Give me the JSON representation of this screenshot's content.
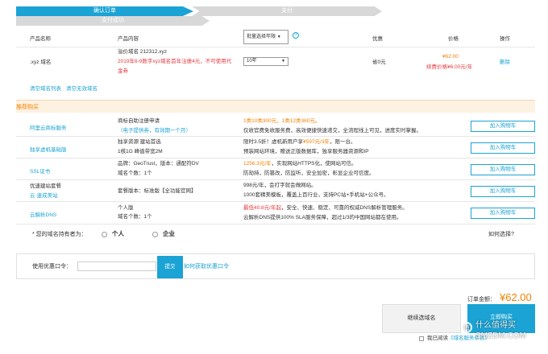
{
  "steps": {
    "s1": "确认订单",
    "s2": "支付",
    "s3": "支付成功"
  },
  "table_header": {
    "product_name": "产品名称",
    "product_content": "产品内容",
    "years_select": "批量选择年限",
    "discount": "优惠",
    "price": "价格",
    "action": "操作"
  },
  "order_item": {
    "name": ".xyz 域名",
    "content_line1": "溢价域名 212312.xyz",
    "content_line2": "2019年6-9数字xyz域名首年注册4元，不可使用代",
    "content_line3": "金券",
    "years": "10年",
    "discount": "省0元",
    "price": "¥62.00",
    "renew_price": "续费价格¥6.00元/年",
    "delete": "删除"
  },
  "links": {
    "clear_list": "清空域名列表",
    "clear_invalid": "清空无效域名"
  },
  "recommend": {
    "title": "推荐购买",
    "add_cart": "加入购物车",
    "items": [
      {
        "name": "阿里云商标服务",
        "content1": "商标自助注册申请",
        "content2": "（电子提供券，有效期一个月）",
        "desc1": "1类10类300元，1类12类360元。",
        "desc2": "仅收官费免收服务费，高效便捷快速递交，全流程线上可见，进度实时掌握。"
      },
      {
        "name": "独享虚机基础版",
        "content1": "独享资源 建站首选",
        "content2": "1核1G 峰值带宽2M",
        "desc1_prefix": "限时3.5折！虚机新用户享",
        "desc1_price": "¥597元/3年",
        "desc1_suffix": "，限一台。",
        "desc2": "预装网站环境，赠送正版数据库，独享服务器资源和IP"
      },
      {
        "name": "SSL证书",
        "content1": "品牌：GeoTrust，版本：通配符DV",
        "content2": "域名个数：1个",
        "desc1_price": "1256.3元/年",
        "desc1_suffix": "，实现网站HTTPS化，使网站可信。",
        "desc2": "防劫持，防篡改，防监听，安全加密，彰显企业可信度。"
      },
      {
        "name": "优速建站套餐",
        "name2": "云·速成美站",
        "content1": "套餐版本：标准版【全功能官网】",
        "desc1": "998元/年，会打字就会做网站。",
        "desc2": "1000套精美模板，覆盖上百行业，支持PC站+手机站+公众号。"
      },
      {
        "name": "云解析DNS",
        "content1": "个人版",
        "content2": "域名个数：1个",
        "desc1_price": "最低40.8元/年起",
        "desc1_suffix": "，安全、快速、稳定、可靠的权威DNS解析管理服务。",
        "desc2": "云解析DNS提供100% SLA服务保障，超过1/3的中国网站都在使用。"
      }
    ]
  },
  "holder": {
    "label": "* 您的域名持有者为：",
    "personal": "个人",
    "enterprise": "企业",
    "how_to_choose": "如何选择?"
  },
  "coupon": {
    "label": "使用优惠口令：",
    "value": "",
    "submit": "提交",
    "how_to_get": "如何获取优惠口令"
  },
  "footer": {
    "total_label": "订单金额：",
    "total": "¥62.00",
    "continue": "继续选域名",
    "buy_now": "立即购买",
    "agree_prefix": "我已阅读",
    "agree_link": "《域名服务条款》"
  },
  "watermark": "什么值得买 SMZDM.COM",
  "colors": {
    "accent": "#1aa3d4",
    "orange": "#f08300",
    "red": "#e4393c",
    "recommend_bg": "#fdf1e2"
  }
}
